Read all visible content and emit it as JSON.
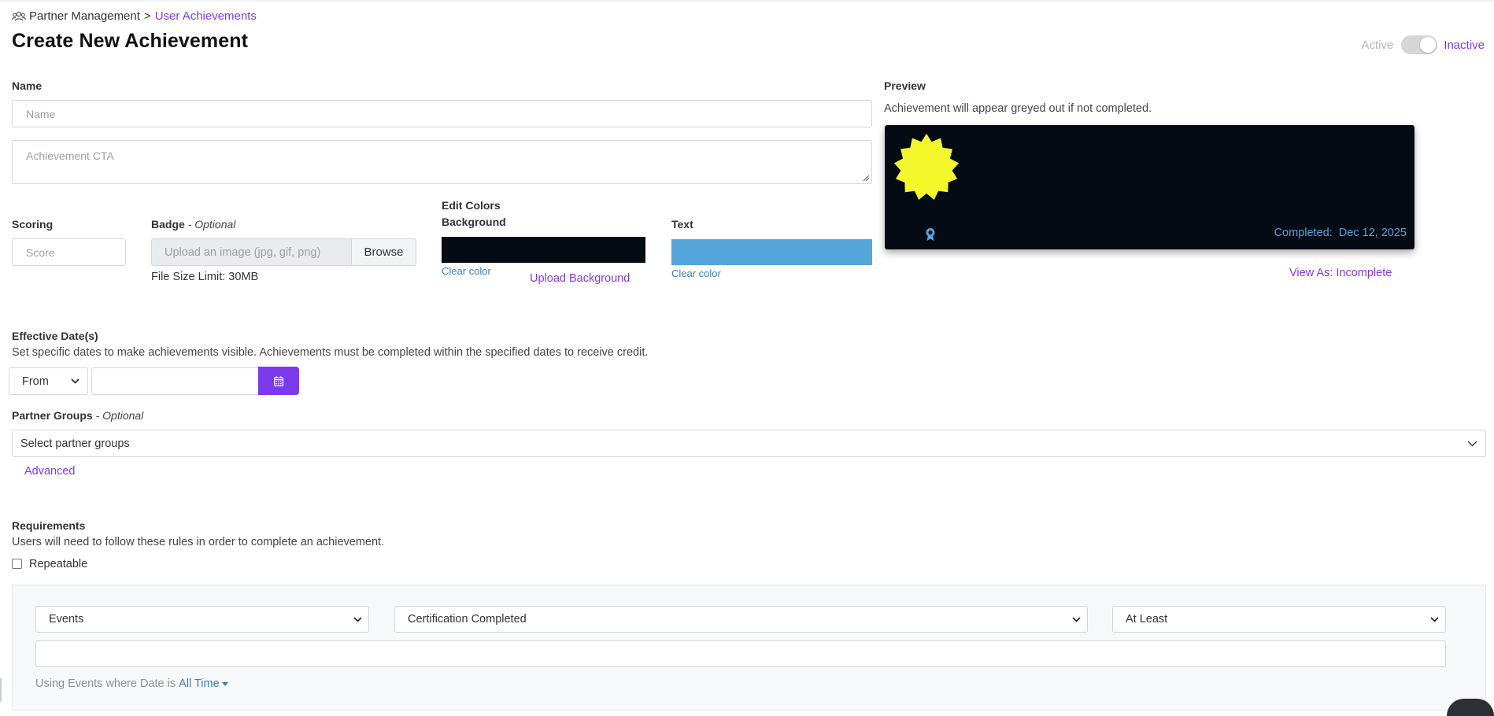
{
  "breadcrumb": {
    "icon": "users-icon",
    "parent": "Partner Management",
    "separator": ">",
    "current": "User Achievements"
  },
  "page": {
    "title": "Create New Achievement"
  },
  "status": {
    "active_label": "Active",
    "inactive_label": "Inactive",
    "is_active": false
  },
  "form": {
    "name_label": "Name",
    "name_placeholder": "Name",
    "cta_placeholder": "Achievement CTA",
    "scoring_label": "Scoring",
    "score_placeholder": "Score",
    "badge_label": "Badge",
    "badge_optional": "- Optional",
    "badge_placeholder": "Upload an image (jpg, gif, png)",
    "browse_label": "Browse",
    "file_size_limit": "File Size Limit: 30MB",
    "edit_colors_label": "Edit Colors",
    "background_label": "Background",
    "background_color": "#040b14",
    "clear_color_bg": "Clear color",
    "upload_background": "Upload Background",
    "text_label": "Text",
    "text_color": "#55a6db",
    "clear_color_text": "Clear color"
  },
  "preview": {
    "label": "Preview",
    "note": "Achievement will appear greyed out if not completed.",
    "badge_color": "#f4f72a",
    "badge_icon": "starburst-badge-icon",
    "ribbon_icon": "ribbon-award-icon",
    "completed_label": "Completed:",
    "completed_date": "Dec 12, 2025",
    "view_as": "View As: Incomplete"
  },
  "dates": {
    "label": "Effective Date(s)",
    "description": "Set specific dates to make achievements visible. Achievements must be completed within the specified dates to receive credit.",
    "from_option": "From",
    "date_value": "",
    "calendar_icon": "calendar-icon"
  },
  "partner_groups": {
    "label": "Partner Groups",
    "optional": "- Optional",
    "placeholder": "Select partner groups",
    "advanced_link": "Advanced"
  },
  "requirements": {
    "label": "Requirements",
    "description": "Users will need to follow these rules in order to complete an achievement.",
    "repeatable_label": "Repeatable",
    "repeatable_checked": false,
    "rule": {
      "source": "Events",
      "event": "Certification Completed",
      "comparator": "At Least",
      "value": "",
      "hint_prefix": "Using Events where Date is",
      "time_range": "All Time"
    }
  },
  "colors": {
    "accent": "#7c3aed",
    "link_blue": "#3a7fb2"
  }
}
